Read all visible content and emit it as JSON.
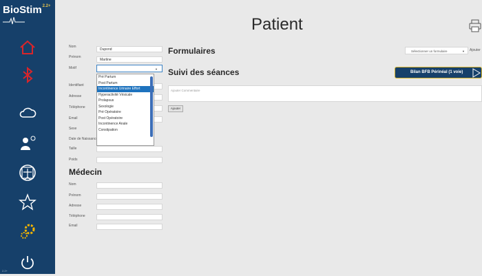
{
  "app": {
    "name": "BioStim",
    "version": "2.2+",
    "page_title": "Patient"
  },
  "sidebar": {
    "items": [
      "home-icon",
      "bluetooth-icon",
      "cloud-icon",
      "patient-history-icon",
      "vitruvian-icon",
      "star-icon",
      "settings-icon",
      "power-icon"
    ],
    "version_label": "2.2+"
  },
  "patient": {
    "nom": {
      "label": "Nom",
      "value": "Dupond"
    },
    "prenom": {
      "label": "Prénom",
      "value": "Martine"
    },
    "motif": {
      "label": "Motif",
      "value": "",
      "options": [
        "Pré Partum",
        "Post Partum",
        "Incontinence Urinaire Effort",
        "Hyperactivité Vésicale",
        "Prolapsus",
        "Sexologie",
        "Pré Opératoire",
        "Post Opératoire",
        "Incontinence Anale",
        "Constipation"
      ],
      "selected": "Incontinence Urinaire Effort"
    },
    "identifiant": {
      "label": "Identifiant"
    },
    "adresse": {
      "label": "Adresse"
    },
    "telephone": {
      "label": "Téléphone"
    },
    "email": {
      "label": "Email"
    },
    "sexe": {
      "label": "Sexe"
    },
    "date_naissance": {
      "label": "Date de Naissance"
    },
    "taille": {
      "label": "Taille"
    },
    "poids": {
      "label": "Poids"
    }
  },
  "medecin": {
    "title": "Médecin",
    "nom": {
      "label": "Nom"
    },
    "prenom": {
      "label": "Prénom"
    },
    "adresse": {
      "label": "Adresse"
    },
    "telephone": {
      "label": "Téléphone"
    },
    "email": {
      "label": "Email"
    }
  },
  "formulaires": {
    "title": "Formulaires",
    "select_placeholder": "Sélectionner un formulaire",
    "add_label": "Ajouter"
  },
  "suivi": {
    "title": "Suivi des séances",
    "bilan_button": "Bilan BFB Périnéal (1 voie)",
    "comment_placeholder": "Ajouter Commentaire",
    "add_button": "Ajouter"
  },
  "colors": {
    "sidebar": "#16406a",
    "icon_red": "#d9252a",
    "accent_gold": "#d9b429",
    "selected": "#1e73be"
  }
}
